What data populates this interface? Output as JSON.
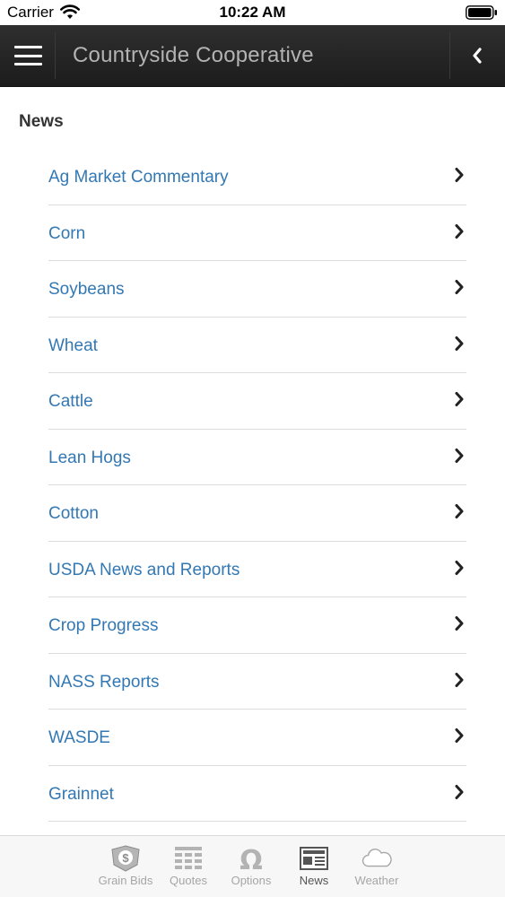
{
  "status_bar": {
    "carrier": "Carrier",
    "time": "10:22 AM"
  },
  "nav": {
    "title": "Countryside Cooperative",
    "menu_icon": "hamburger-icon",
    "back_icon": "chevron-left-icon"
  },
  "main": {
    "section_title": "News",
    "items": [
      {
        "label": "Ag Market Commentary"
      },
      {
        "label": "Corn"
      },
      {
        "label": "Soybeans"
      },
      {
        "label": "Wheat"
      },
      {
        "label": "Cattle"
      },
      {
        "label": "Lean Hogs"
      },
      {
        "label": "Cotton"
      },
      {
        "label": "USDA News and Reports"
      },
      {
        "label": "Crop Progress"
      },
      {
        "label": "NASS Reports"
      },
      {
        "label": "WASDE"
      },
      {
        "label": "Grainnet"
      }
    ]
  },
  "tab_bar": {
    "tabs": [
      {
        "label": "Grain Bids",
        "icon": "dollar-badge-icon"
      },
      {
        "label": "Quotes",
        "icon": "table-grid-icon"
      },
      {
        "label": "Options",
        "icon": "omega-icon"
      },
      {
        "label": "News",
        "icon": "newspaper-icon",
        "active": true
      },
      {
        "label": "Weather",
        "icon": "cloud-icon"
      }
    ]
  },
  "colors": {
    "nav_bg": "#222222",
    "nav_title": "#b3b3b3",
    "link": "#3378b3",
    "divider": "#dcdcdc",
    "tab_inactive": "#a6a6a6",
    "tab_active": "#555555"
  }
}
